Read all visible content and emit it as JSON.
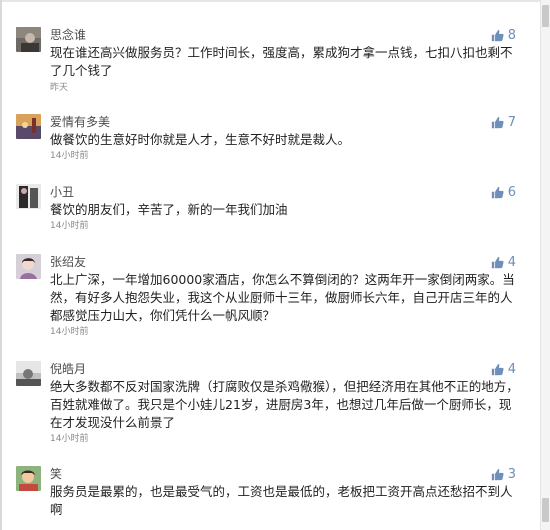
{
  "comments": [
    {
      "user": "思念谁",
      "likes": "8",
      "text": "现在谁还高兴做服务员？工作时间长，强度高，累成狗才拿一点钱，七扣八扣也剩不了几个钱了",
      "time": "昨天"
    },
    {
      "user": "爱情有多美",
      "likes": "7",
      "text": "做餐饮的生意好时你就是人才，生意不好时就是裁人。",
      "time": "14小时前"
    },
    {
      "user": "小丑",
      "likes": "6",
      "text": "餐饮的朋友们，辛苦了，新的一年我们加油",
      "time": "14小时前"
    },
    {
      "user": "张绍友",
      "likes": "4",
      "text": "北上广深，一年增加60000家酒店，你怎么不算倒闭的？这两年开一家倒闭两家。当然，有好多人抱怨失业，我这个从业厨师十三年，做厨师长六年，自己开店三年的人都感觉压力山大，你们凭什么一帆风顺？",
      "time": "14小时前"
    },
    {
      "user": "倪皓月",
      "likes": "4",
      "text": "绝大多数都不反对国家洗牌（打腐败仅是杀鸡儆猴），但把经济用在其他不正的地方，百姓就难做了。我只是个小娃儿21岁，进厨房3年，也想过几年后做一个厨师长，现在才发现没什么前景了",
      "time": "14小时前"
    },
    {
      "user": "笑",
      "likes": "3",
      "text": "服务员是最累的，也是最受气的，工资也是最低的，老板把工资开高点还愁招不到人啊",
      "time": ""
    }
  ],
  "icons": {
    "like": "thumbs-up-icon"
  },
  "colors": {
    "like": "#6f8fb9",
    "text": "#1f1f1f",
    "username": "#4c4c4c",
    "time": "#8a8a8a"
  }
}
